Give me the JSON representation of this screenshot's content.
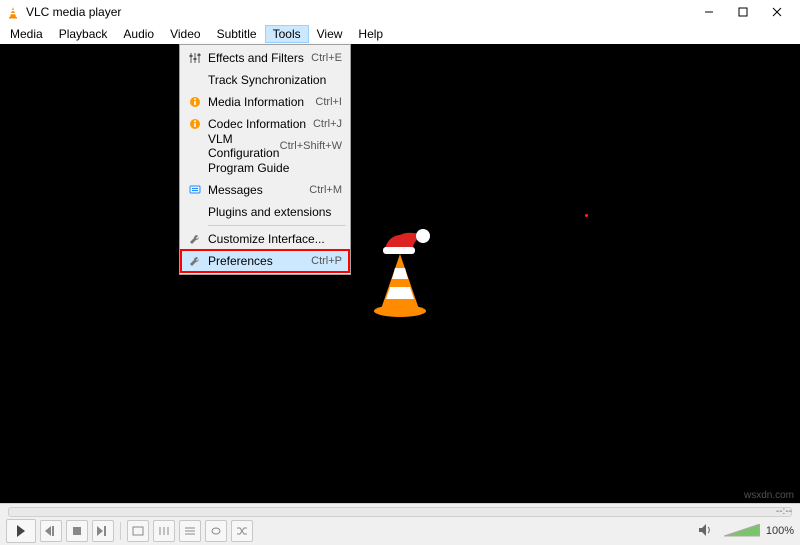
{
  "title": "VLC media player",
  "menu": {
    "items": [
      "Media",
      "Playback",
      "Audio",
      "Video",
      "Subtitle",
      "Tools",
      "View",
      "Help"
    ],
    "open_index": 5
  },
  "tools_menu": [
    {
      "icon": "equalizer",
      "label": "Effects and Filters",
      "shortcut": "Ctrl+E"
    },
    {
      "icon": "",
      "label": "Track Synchronization",
      "shortcut": ""
    },
    {
      "icon": "info",
      "label": "Media Information",
      "shortcut": "Ctrl+I"
    },
    {
      "icon": "info",
      "label": "Codec Information",
      "shortcut": "Ctrl+J"
    },
    {
      "icon": "",
      "label": "VLM Configuration",
      "shortcut": "Ctrl+Shift+W"
    },
    {
      "icon": "",
      "label": "Program Guide",
      "shortcut": ""
    },
    {
      "icon": "messages",
      "label": "Messages",
      "shortcut": "Ctrl+M"
    },
    {
      "icon": "",
      "label": "Plugins and extensions",
      "shortcut": ""
    },
    {
      "sep": true
    },
    {
      "icon": "wrench",
      "label": "Customize Interface...",
      "shortcut": ""
    },
    {
      "icon": "wrench",
      "label": "Preferences",
      "shortcut": "Ctrl+P",
      "highlight": true
    }
  ],
  "seek": {
    "left": "--:--",
    "right": "--:--"
  },
  "volume": {
    "pct": "100%"
  },
  "watermark": "wsxdn.com"
}
